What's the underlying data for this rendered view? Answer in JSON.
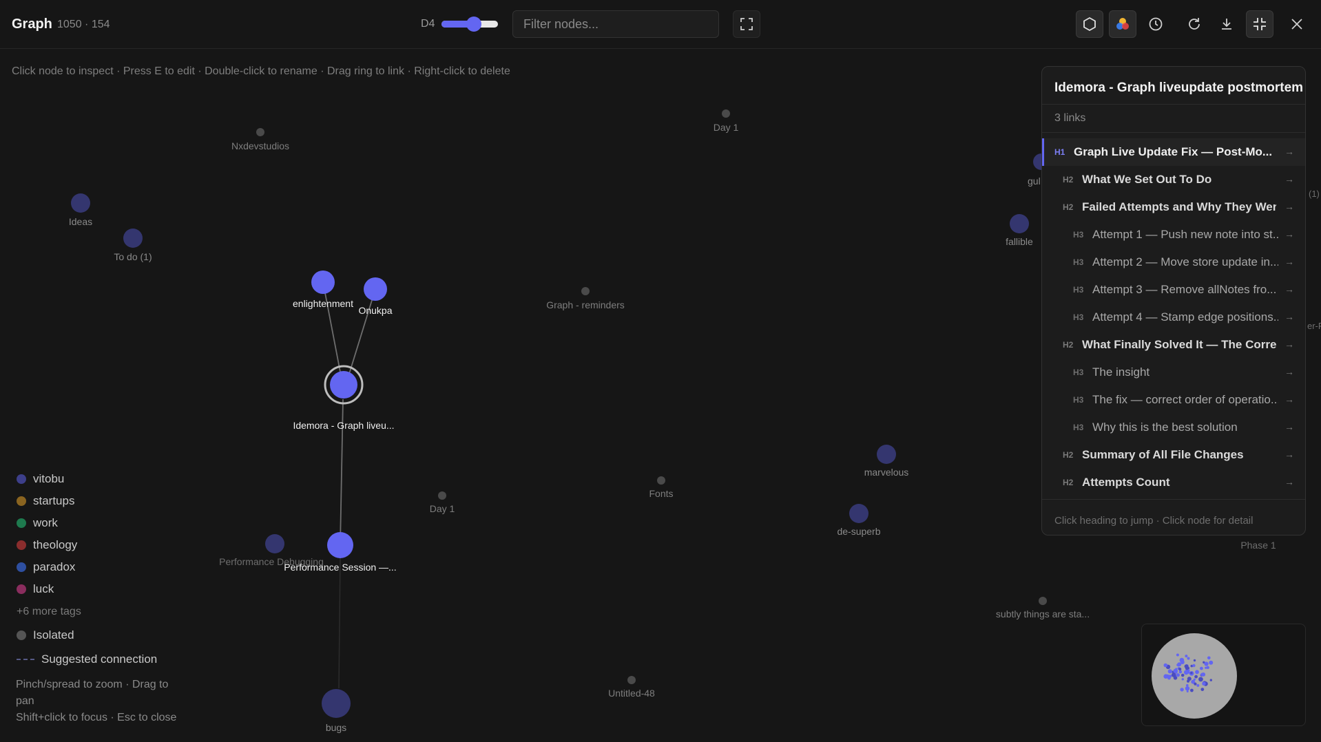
{
  "header": {
    "title": "Graph",
    "counts": "1050 · 154",
    "depth_label": "D4",
    "depth_value": 0.6,
    "filter_placeholder": "Filter nodes..."
  },
  "toolbar_icons": [
    "fullscreen-icon",
    "hexagon-icon",
    "color-palette-icon",
    "clock-icon",
    "refresh-icon",
    "download-icon",
    "collapse-icon",
    "close-icon"
  ],
  "hint": "Click node to inspect · Press E to edit · Double-click to rename · Drag ring to link · Right-click to delete",
  "nodes": {
    "nxdevstudios": "Nxdevstudios",
    "day1_top": "Day 1",
    "ideas": "Ideas",
    "todo": "To do (1)",
    "fallible": "fallible",
    "enlightenment": "enlightenment",
    "onukpa": "Onukpa",
    "graph_reminders": "Graph - reminders",
    "idemora": "Idemora - Graph liveu...",
    "marvelous": "marvelous",
    "fonts": "Fonts",
    "day1_mid": "Day 1",
    "de_superb": "de-superb",
    "perf_debugging": "Performance Debugging",
    "perf_session": "Performance Session —...",
    "phase1": "Phase 1",
    "subtly": "subtly things are sta...",
    "untitled48": "Untitled-48",
    "bugs": "bugs",
    "gu_partial": "gul",
    "edge_partial_1": "(1)",
    "edge_partial_2": "er-P"
  },
  "legend": {
    "tags": [
      {
        "name": "vitobu",
        "color": "#3d3f8a"
      },
      {
        "name": "startups",
        "color": "#8a6420"
      },
      {
        "name": "work",
        "color": "#1e7a4e"
      },
      {
        "name": "theology",
        "color": "#8a2d2d"
      },
      {
        "name": "paradox",
        "color": "#2e4fa0"
      },
      {
        "name": "luck",
        "color": "#8a2d5e"
      }
    ],
    "more": "+6 more tags",
    "isolated": "Isolated",
    "suggested": "Suggested connection"
  },
  "help": {
    "line1": "Pinch/spread to zoom · Drag to pan",
    "line2": "Shift+click to focus · Esc to close"
  },
  "panel": {
    "title": "Idemora - Graph liveupdate postmortem",
    "links": "3 links",
    "footer": "Click heading to jump · Click node for detail",
    "headings": [
      {
        "level": "H1",
        "text": "Graph Live Update Fix — Post-Mo..."
      },
      {
        "level": "H2",
        "text": "What We Set Out To Do"
      },
      {
        "level": "H2",
        "text": "Failed Attempts and Why They Wer..."
      },
      {
        "level": "H3",
        "text": "Attempt 1 — Push new note into st..."
      },
      {
        "level": "H3",
        "text": "Attempt 2 — Move store update in..."
      },
      {
        "level": "H3",
        "text": "Attempt 3 — Remove allNotes fro..."
      },
      {
        "level": "H3",
        "text": "Attempt 4 — Stamp edge positions..."
      },
      {
        "level": "H2",
        "text": "What Finally Solved It — The Correc..."
      },
      {
        "level": "H3",
        "text": "The insight"
      },
      {
        "level": "H3",
        "text": "The fix — correct order of operatio..."
      },
      {
        "level": "H3",
        "text": "Why this is the best solution"
      },
      {
        "level": "H2",
        "text": "Summary of All File Changes"
      },
      {
        "level": "H2",
        "text": "Attempts Count"
      }
    ]
  },
  "colors": {
    "accent": "#6366f1",
    "node_dim": "#3b3d78",
    "node_gray": "#4a4a4a"
  }
}
